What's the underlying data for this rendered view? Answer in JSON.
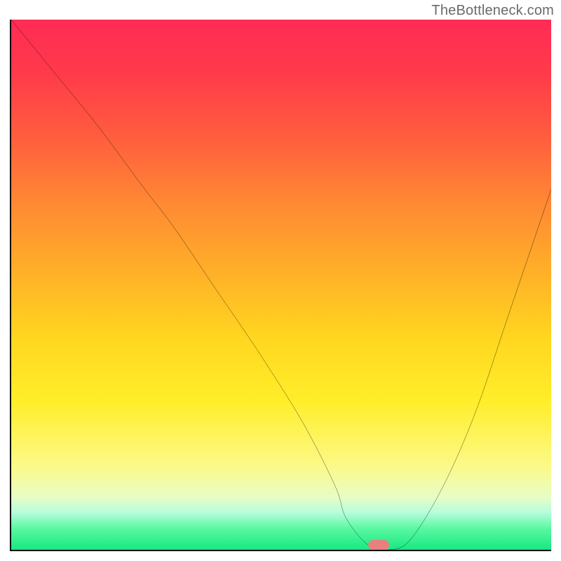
{
  "watermark": "TheBottleneck.com",
  "chart_data": {
    "type": "line",
    "title": "",
    "xlabel": "",
    "ylabel": "",
    "xlim": [
      0,
      100
    ],
    "ylim": [
      0,
      100
    ],
    "grid": false,
    "legend": false,
    "annotations": [],
    "series": [
      {
        "name": "curve",
        "x": [
          0,
          8,
          16,
          24,
          30,
          38,
          46,
          54,
          60,
          62,
          66,
          70,
          74,
          80,
          86,
          92,
          100
        ],
        "values": [
          100,
          90,
          80,
          69,
          61,
          49,
          37,
          24,
          12,
          6,
          1,
          0,
          2,
          12,
          26,
          44,
          68
        ]
      }
    ],
    "gradient_stops": [
      {
        "pos": 0,
        "color": "#ff2b55"
      },
      {
        "pos": 10,
        "color": "#ff3a4a"
      },
      {
        "pos": 22,
        "color": "#ff5d3e"
      },
      {
        "pos": 35,
        "color": "#ff8a33"
      },
      {
        "pos": 48,
        "color": "#ffb128"
      },
      {
        "pos": 60,
        "color": "#ffd61f"
      },
      {
        "pos": 72,
        "color": "#ffee2a"
      },
      {
        "pos": 84,
        "color": "#fcf986"
      },
      {
        "pos": 90,
        "color": "#e8fdc5"
      },
      {
        "pos": 93,
        "color": "#b6fddc"
      },
      {
        "pos": 96,
        "color": "#59f8a0"
      },
      {
        "pos": 100,
        "color": "#18e884"
      }
    ],
    "marker": {
      "x": 68,
      "y": 0,
      "color": "#e9807e",
      "shape": "pill"
    }
  }
}
